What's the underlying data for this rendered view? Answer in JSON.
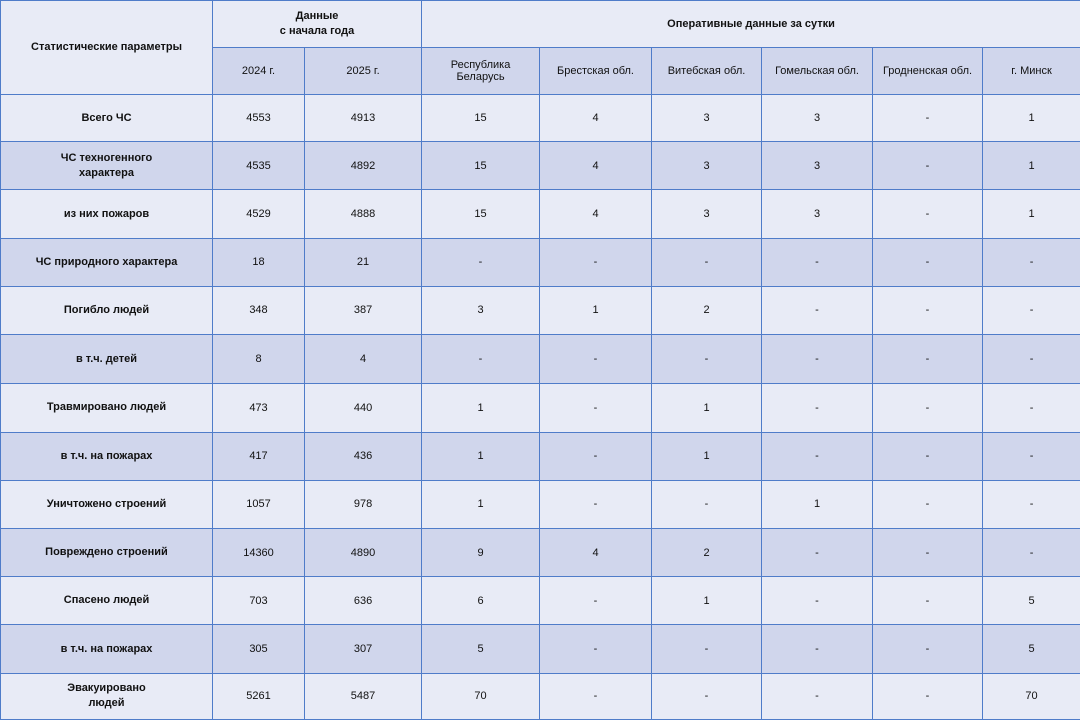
{
  "header": {
    "param_title": "Статистические параметры",
    "ytd_title": "Данные\nс начала года",
    "ops_title": "Оперативные данные за сутки",
    "columns": [
      "2024 г.",
      "2025 г.",
      "Республика Беларусь",
      "Брестская обл.",
      "Витебская обл.",
      "Гомельская обл.",
      "Гродненская обл.",
      "г. Минск"
    ]
  },
  "rows": [
    {
      "label": "Всего ЧС",
      "values": [
        "4553",
        "4913",
        "15",
        "4",
        "3",
        "3",
        "-",
        "1"
      ]
    },
    {
      "label": "ЧС техногенного\nхарактера",
      "values": [
        "4535",
        "4892",
        "15",
        "4",
        "3",
        "3",
        "-",
        "1"
      ]
    },
    {
      "label": "из них пожаров",
      "values": [
        "4529",
        "4888",
        "15",
        "4",
        "3",
        "3",
        "-",
        "1"
      ]
    },
    {
      "label": "ЧС природного характера",
      "values": [
        "18",
        "21",
        "-",
        "-",
        "-",
        "-",
        "-",
        "-"
      ]
    },
    {
      "label": "Погибло людей",
      "values": [
        "348",
        "387",
        "3",
        "1",
        "2",
        "-",
        "-",
        "-"
      ]
    },
    {
      "label": "в т.ч. детей",
      "values": [
        "8",
        "4",
        "-",
        "-",
        "-",
        "-",
        "-",
        "-"
      ]
    },
    {
      "label": "Травмировано людей",
      "values": [
        "473",
        "440",
        "1",
        "-",
        "1",
        "-",
        "-",
        "-"
      ]
    },
    {
      "label": "в т.ч. на пожарах",
      "values": [
        "417",
        "436",
        "1",
        "-",
        "1",
        "-",
        "-",
        "-"
      ]
    },
    {
      "label": "Уничтожено строений",
      "values": [
        "1057",
        "978",
        "1",
        "-",
        "-",
        "1",
        "-",
        "-"
      ]
    },
    {
      "label": "Повреждено строений",
      "values": [
        "14360",
        "4890",
        "9",
        "4",
        "2",
        "-",
        "-",
        "-"
      ]
    },
    {
      "label": "Спасено людей",
      "values": [
        "703",
        "636",
        "6",
        "-",
        "1",
        "-",
        "-",
        "5"
      ]
    },
    {
      "label": "в т.ч. на пожарах",
      "values": [
        "305",
        "307",
        "5",
        "-",
        "-",
        "-",
        "-",
        "5"
      ]
    },
    {
      "label": "Эвакуировано\nлюдей",
      "values": [
        "5261",
        "5487",
        "70",
        "-",
        "-",
        "-",
        "-",
        "70"
      ]
    }
  ],
  "colors": {
    "border": "#4f7cc9",
    "row_light": "#e8ebf6",
    "row_dark": "#d0d6ec"
  }
}
